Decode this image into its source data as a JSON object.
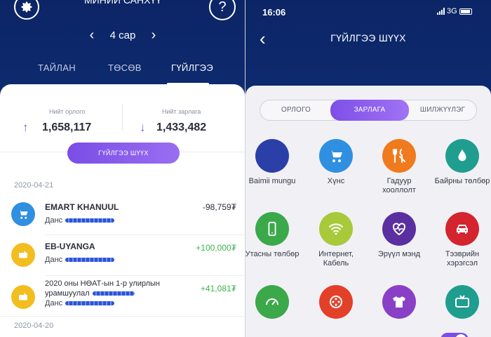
{
  "left": {
    "title": "МИНИЙ САНХҮҮ",
    "period": {
      "label": "4 сар",
      "prev": "‹",
      "next": "›"
    },
    "help": "?",
    "tabs": [
      {
        "label": "ТАЙЛАН"
      },
      {
        "label": "ТӨСӨВ"
      },
      {
        "label": "ГҮЙЛГЭЭ"
      }
    ],
    "summary": {
      "income_label": "Нийт орлого",
      "income_value": "1,658,117",
      "income_arrow": "↑",
      "expense_label": "Нийт зарлага",
      "expense_value": "1,433,482",
      "expense_arrow": "↓"
    },
    "search_button": "ГҮЙЛГЭЭ ШҮҮХ",
    "groups": [
      {
        "date": "2020-04-21",
        "transactions": [
          {
            "name": "EMART KHANUUL",
            "account_label": "Данс",
            "amount": "-98,759₮",
            "type": "debit",
            "icon": "cart-icon"
          },
          {
            "name": "EB-UYANGA",
            "account_label": "Данс",
            "amount": "+100,000₮",
            "type": "credit",
            "icon": "transfer-icon"
          },
          {
            "name": "2020 оны НӨАТ-ын 1-р улирлын",
            "name2": "урамшуулал",
            "account_label": "Данс",
            "amount": "+41,081₮",
            "type": "credit",
            "icon": "transfer-icon"
          }
        ]
      },
      {
        "date": "2020-04-20"
      }
    ]
  },
  "right": {
    "status": {
      "time": "16:06",
      "network": "3G"
    },
    "back": "‹",
    "title": "ГҮЙЛГЭЭ ШҮҮХ",
    "segments": [
      {
        "label": "ОРЛОГО"
      },
      {
        "label": "ЗАРЛАГА"
      },
      {
        "label": "ШИЛЖҮҮЛЭГ"
      }
    ],
    "categories": [
      {
        "label": "Baimii mungu",
        "icon": "circle-icon",
        "color": "#2b3fa8"
      },
      {
        "label": "Хүнс",
        "icon": "cart-icon",
        "color": "#2f8fe0"
      },
      {
        "label": "Гадуур хооллолт",
        "icon": "fork-knife-icon",
        "color": "#f07a1e"
      },
      {
        "label": "Байрны төлбөр",
        "icon": "water-drop-icon",
        "color": "#1f9e8f"
      },
      {
        "label": "Утасны төлбөр",
        "icon": "phone-icon",
        "color": "#3ba84a"
      },
      {
        "label": "Интернет, Кабель",
        "icon": "wifi-icon",
        "color": "#a8c93a"
      },
      {
        "label": "Эрүүл мэнд",
        "icon": "heart-icon",
        "color": "#5a2fa0"
      },
      {
        "label": "Тээврийн хэрэгсэл",
        "icon": "car-icon",
        "color": "#d3242f"
      },
      {
        "label": "",
        "icon": "gauge-icon",
        "color": "#3ba84a"
      },
      {
        "label": "",
        "icon": "film-icon",
        "color": "#e3402a"
      },
      {
        "label": "",
        "icon": "shirt-icon",
        "color": "#8a3fc7"
      },
      {
        "label": "",
        "icon": "tv-icon",
        "color": "#1f9e8f"
      }
    ]
  }
}
